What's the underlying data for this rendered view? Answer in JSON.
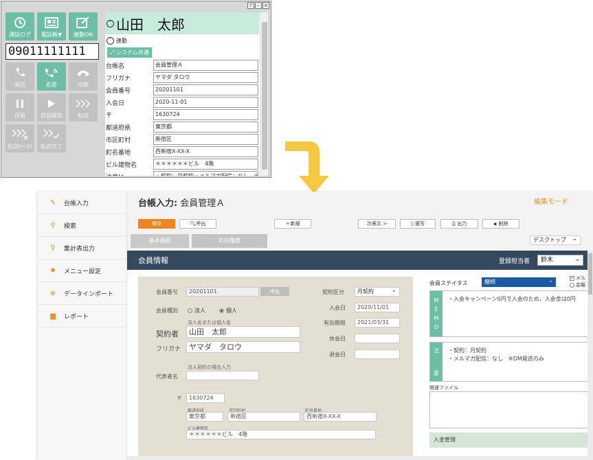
{
  "phone": {
    "window_buttons": [
      "?",
      "–",
      "×"
    ],
    "top_buttons": [
      {
        "label": "通話ログ",
        "icon": "call-log-icon"
      },
      {
        "label": "電話帳▼",
        "icon": "phonebook-icon"
      },
      {
        "label": "連動ON",
        "icon": "link-on-icon"
      }
    ],
    "number": "09011111111",
    "action_buttons": [
      {
        "label": "発信",
        "icon": "phone-icon",
        "state": "disabled"
      },
      {
        "label": "応答",
        "icon": "answer-icon",
        "state": "active"
      },
      {
        "label": "切断",
        "icon": "hangup-icon",
        "state": "disabled"
      },
      {
        "label": "保留",
        "icon": "pause-icon",
        "state": "disabled"
      },
      {
        "label": "保留解除",
        "icon": "play-icon",
        "state": "disabled"
      },
      {
        "label": "転送",
        "icon": "forward-icon",
        "state": "disabled"
      },
      {
        "label": "転送ｷｬﾝｾﾙ",
        "icon": "transfer-cancel-icon",
        "state": "disabled"
      },
      {
        "label": "転送完了",
        "icon": "transfer-done-icon",
        "state": "disabled"
      }
    ],
    "caller_name": "山田　太郎",
    "renku_label": "連動",
    "system_share_label": "システム共通",
    "fields": [
      {
        "key": "台帳名",
        "value": "会員管理Ａ"
      },
      {
        "key": "フリガナ",
        "value": "ヤマダ タロウ"
      },
      {
        "key": "会員番号",
        "value": "20201101"
      },
      {
        "key": "入会日",
        "value": "2020-11-01"
      },
      {
        "key": "〒",
        "value": "1630724"
      },
      {
        "key": "都道府県",
        "value": "東京都"
      },
      {
        "key": "市区町村",
        "value": "新宿区"
      },
      {
        "key": "町名番地",
        "value": "西新宿X-XX-X"
      },
      {
        "key": "ビル建物名",
        "value": "＊＊＊＊＊＊ビル　4階"
      },
      {
        "key": "注意Memo",
        "value": "・契約：月契約・メルマガ配信：なし　※DM"
      }
    ]
  },
  "sidebar": {
    "items": [
      {
        "label": "台帳入力",
        "icon": "pencil-icon"
      },
      {
        "label": "検索",
        "icon": "search-icon"
      },
      {
        "label": "集計表出力",
        "icon": "search-icon"
      },
      {
        "label": "メニュー設定",
        "icon": "gear-icon"
      },
      {
        "label": "データインポート",
        "icon": "import-icon"
      },
      {
        "label": "レポート",
        "icon": "document-icon"
      }
    ]
  },
  "header": {
    "title_prefix": "台帳入力:",
    "title": "会員管理Ａ",
    "edit_mode": "編集モード"
  },
  "toolbar": {
    "save": "保存",
    "call": "🔍呼出",
    "new": "＋新規",
    "next": "次表示 >",
    "copy": "複写",
    "print": "出力",
    "delete": "削除"
  },
  "tabs": [
    "基本画面",
    "応対履歴"
  ],
  "device_select": "デスクトップ",
  "section": {
    "title": "会員情報",
    "staff_label": "登録担当者",
    "staff_value": "鈴木"
  },
  "form": {
    "member_no_label": "会員番号",
    "member_no": "20201101",
    "call_btn": "呼出",
    "type_label": "会員種別",
    "type_options": [
      "法人",
      "個人"
    ],
    "corp_name_hint": "法人名または個人名",
    "contractor_label": "契約者",
    "contractor": "山田　太郎",
    "kana_label": "フリガナ",
    "kana": "ヤマダ　タロウ",
    "rep_hint": "法人契約の場合入力",
    "rep_label": "代表者名",
    "zip_label": "〒",
    "zip": "1630724",
    "pref_label": "都道府県",
    "pref": "東京都",
    "city_label": "市区町村",
    "city": "新宿区",
    "street_label": "町名番地",
    "street": "西新宿X-XX-X",
    "building_label": "ビル建物名",
    "building": "＊＊＊＊＊＊ビル　4階",
    "contract_label": "契約区分",
    "contract": "月契約",
    "join_label": "入会日",
    "join": "2020/11/01",
    "expire_label": "有効期限",
    "expire": "2021/03/31",
    "pause_label": "休会日",
    "leave_label": "退会日"
  },
  "right": {
    "status_label": "会員ステイタス",
    "status": "継続",
    "check1": "メル",
    "check2": "会報",
    "memo_tag": [
      "M",
      "E",
      "M",
      "O"
    ],
    "memo_text": "・入会キャンペーン0円で入会のため、入会金は0円",
    "note_tag": [
      "注",
      "意"
    ],
    "note_lines": [
      "・契約：月契約",
      "・メルマガ配信：なし　※DM発送のみ"
    ],
    "related_label": "関連ファイル",
    "payment_label": "入金管理"
  },
  "colors": {
    "accent_green": "#6cbea5",
    "orange": "#f0851f",
    "navy": "#34495e",
    "status_blue": "#1c5aa6",
    "arrow_yellow": "#f5c842"
  }
}
